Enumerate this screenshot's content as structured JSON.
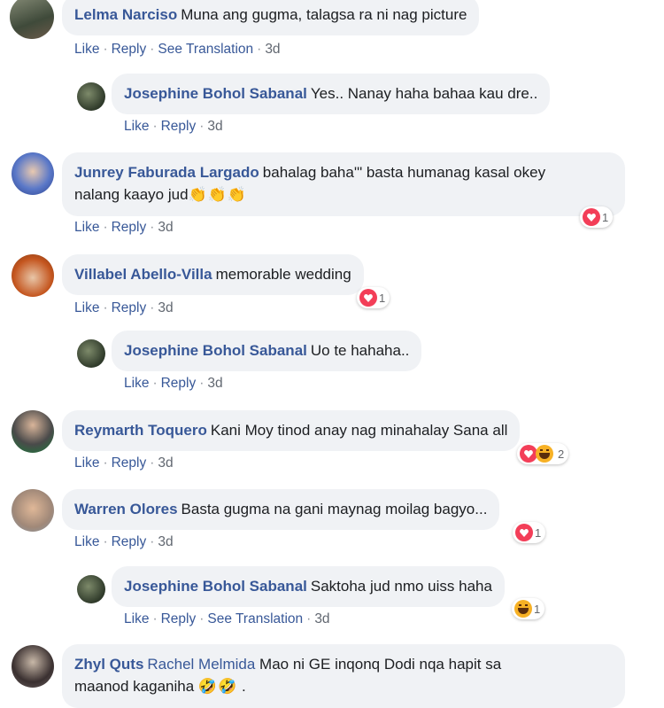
{
  "actions": {
    "like": "Like",
    "reply": "Reply",
    "see_translation": "See Translation",
    "separator": "·"
  },
  "comments": [
    {
      "author": "Lelma Narciso",
      "text": "Muna ang gugma, talagsa ra ni nag picture",
      "time": "3d",
      "has_translation": true
    },
    {
      "author": "Josephine Bohol Sabanal",
      "text": "Yes.. Nanay haha bahaa kau dre..",
      "time": "3d"
    },
    {
      "author": "Junrey Faburada Largado",
      "text_line1": "bahalag baha'\" basta humanag kasal okey",
      "text_line2": "nalang kaayo jud",
      "emoji": "👏👏👏",
      "time": "3d",
      "reaction_count": "1"
    },
    {
      "author": "Villabel Abello-Villa",
      "text": "memorable wedding",
      "time": "3d",
      "reaction_count": "1"
    },
    {
      "author": "Josephine Bohol Sabanal",
      "text": "Uo te hahaha..",
      "time": "3d"
    },
    {
      "author": "Reymarth Toquero",
      "text": "Kani Moy tinod anay nag minahalay Sana all",
      "time": "3d",
      "reaction_count": "2"
    },
    {
      "author": "Warren Olores",
      "text": "Basta gugma na gani maynag moilag bagyo...",
      "time": "3d",
      "reaction_count": "1"
    },
    {
      "author": "Josephine Bohol Sabanal",
      "text": "Saktoha jud nmo uiss haha",
      "time": "3d",
      "has_translation": true,
      "reaction_count": "1"
    },
    {
      "author": "Zhyl Quts",
      "tag": "Rachel Melmida",
      "text_line1": "Mao ni GE inqonq Dodi nqa hapit sa",
      "text_line2": "maanod kaganiha",
      "emoji": "🤣🤣",
      "text_end": "."
    }
  ],
  "icons": {
    "heart": "heart-reaction-icon",
    "haha": "haha-reaction-icon"
  },
  "colors": {
    "link": "#385898",
    "bubble": "#f0f2f5",
    "heart": "#f33e58",
    "haha": "#f7b125"
  }
}
